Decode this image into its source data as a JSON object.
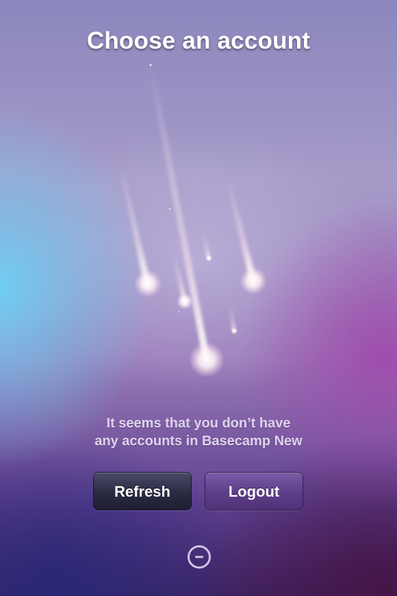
{
  "screen": {
    "title": "Choose an account",
    "message_line1": "It seems that you don’t have",
    "message_line2": "any accounts in Basecamp New"
  },
  "buttons": {
    "refresh_label": "Refresh",
    "logout_label": "Logout"
  },
  "icons": {
    "illustration": "meteor-shower-illustration",
    "activity": "minus-circle-icon"
  },
  "colors": {
    "refresh_button": "#2a2a42",
    "logout_button": "#5d3d88",
    "text": "#ffffff"
  }
}
